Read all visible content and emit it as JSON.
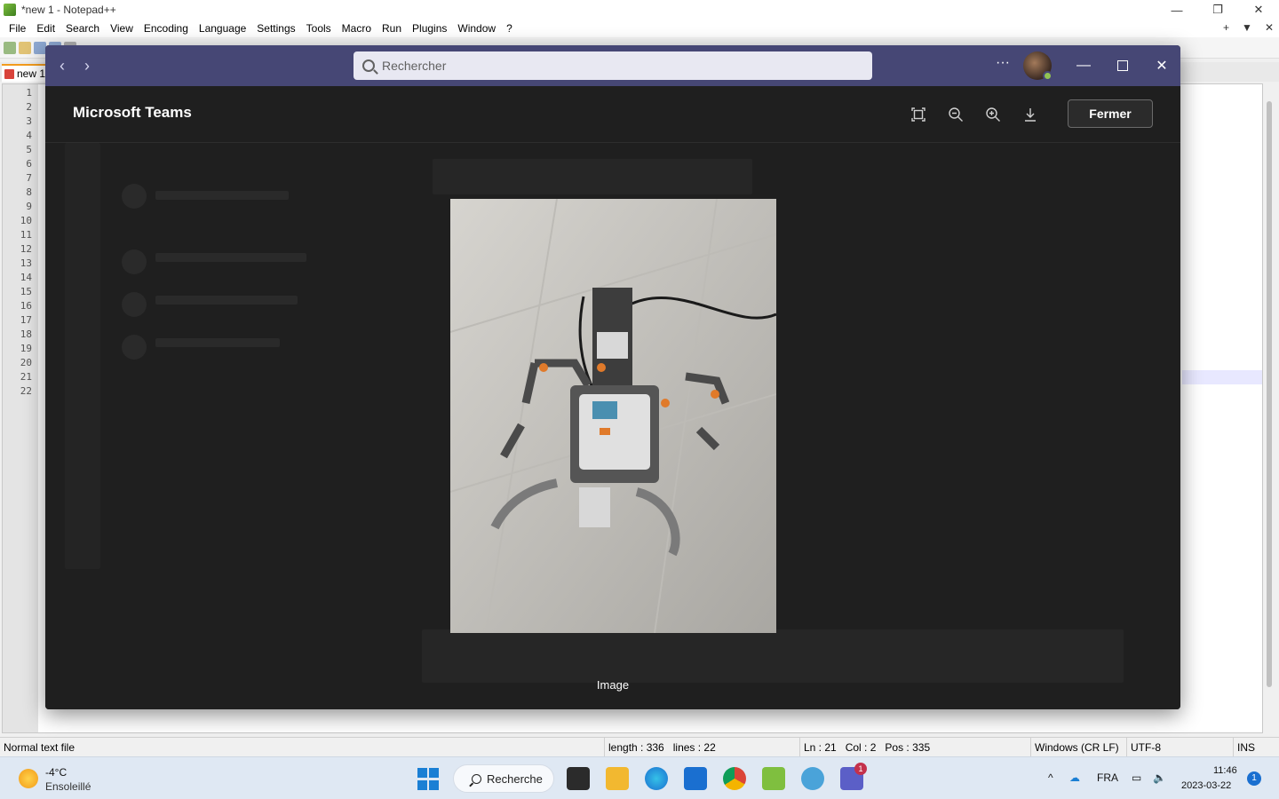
{
  "notepad": {
    "title": "*new 1 - Notepad++",
    "menu": [
      "File",
      "Edit",
      "Search",
      "View",
      "Encoding",
      "Language",
      "Settings",
      "Tools",
      "Macro",
      "Run",
      "Plugins",
      "Window",
      "?"
    ],
    "menu_right": [
      "+",
      "▼",
      "✕"
    ],
    "tab_label": "new 1",
    "line_numbers": [
      "1",
      "2",
      "3",
      "4",
      "5",
      "6",
      "7",
      "8",
      "9",
      "10",
      "11",
      "12",
      "13",
      "14",
      "15",
      "16",
      "17",
      "18",
      "19",
      "20",
      "21",
      "22"
    ],
    "status": {
      "file_type": "Normal text file",
      "length": "length : 336",
      "lines": "lines : 22",
      "ln": "Ln : 21",
      "col": "Col : 2",
      "pos": "Pos : 335",
      "eol": "Windows (CR LF)",
      "encoding": "UTF-8",
      "mode": "INS"
    }
  },
  "teams": {
    "search_placeholder": "Rechercher",
    "more": "···",
    "viewer_title": "Microsoft Teams",
    "close_label": "Fermer",
    "caption": "Image"
  },
  "taskbar": {
    "weather_temp": "-4°C",
    "weather_desc": "Ensoleillé",
    "search_label": "Recherche",
    "teams_badge": "1",
    "language": "FRA",
    "time": "11:46",
    "date": "2023-03-22",
    "notifications": "1"
  },
  "colors": {
    "teams_titlebar": "#464775",
    "viewer_bg": "#1f1f1f",
    "npp_tab_accent": "#f29b1d",
    "taskbar_bg": "#dfe8f3"
  },
  "icons": {
    "fit": "fit-to-window-icon",
    "zoom_out": "zoom-out-icon",
    "zoom_in": "zoom-in-icon",
    "download": "download-icon"
  }
}
